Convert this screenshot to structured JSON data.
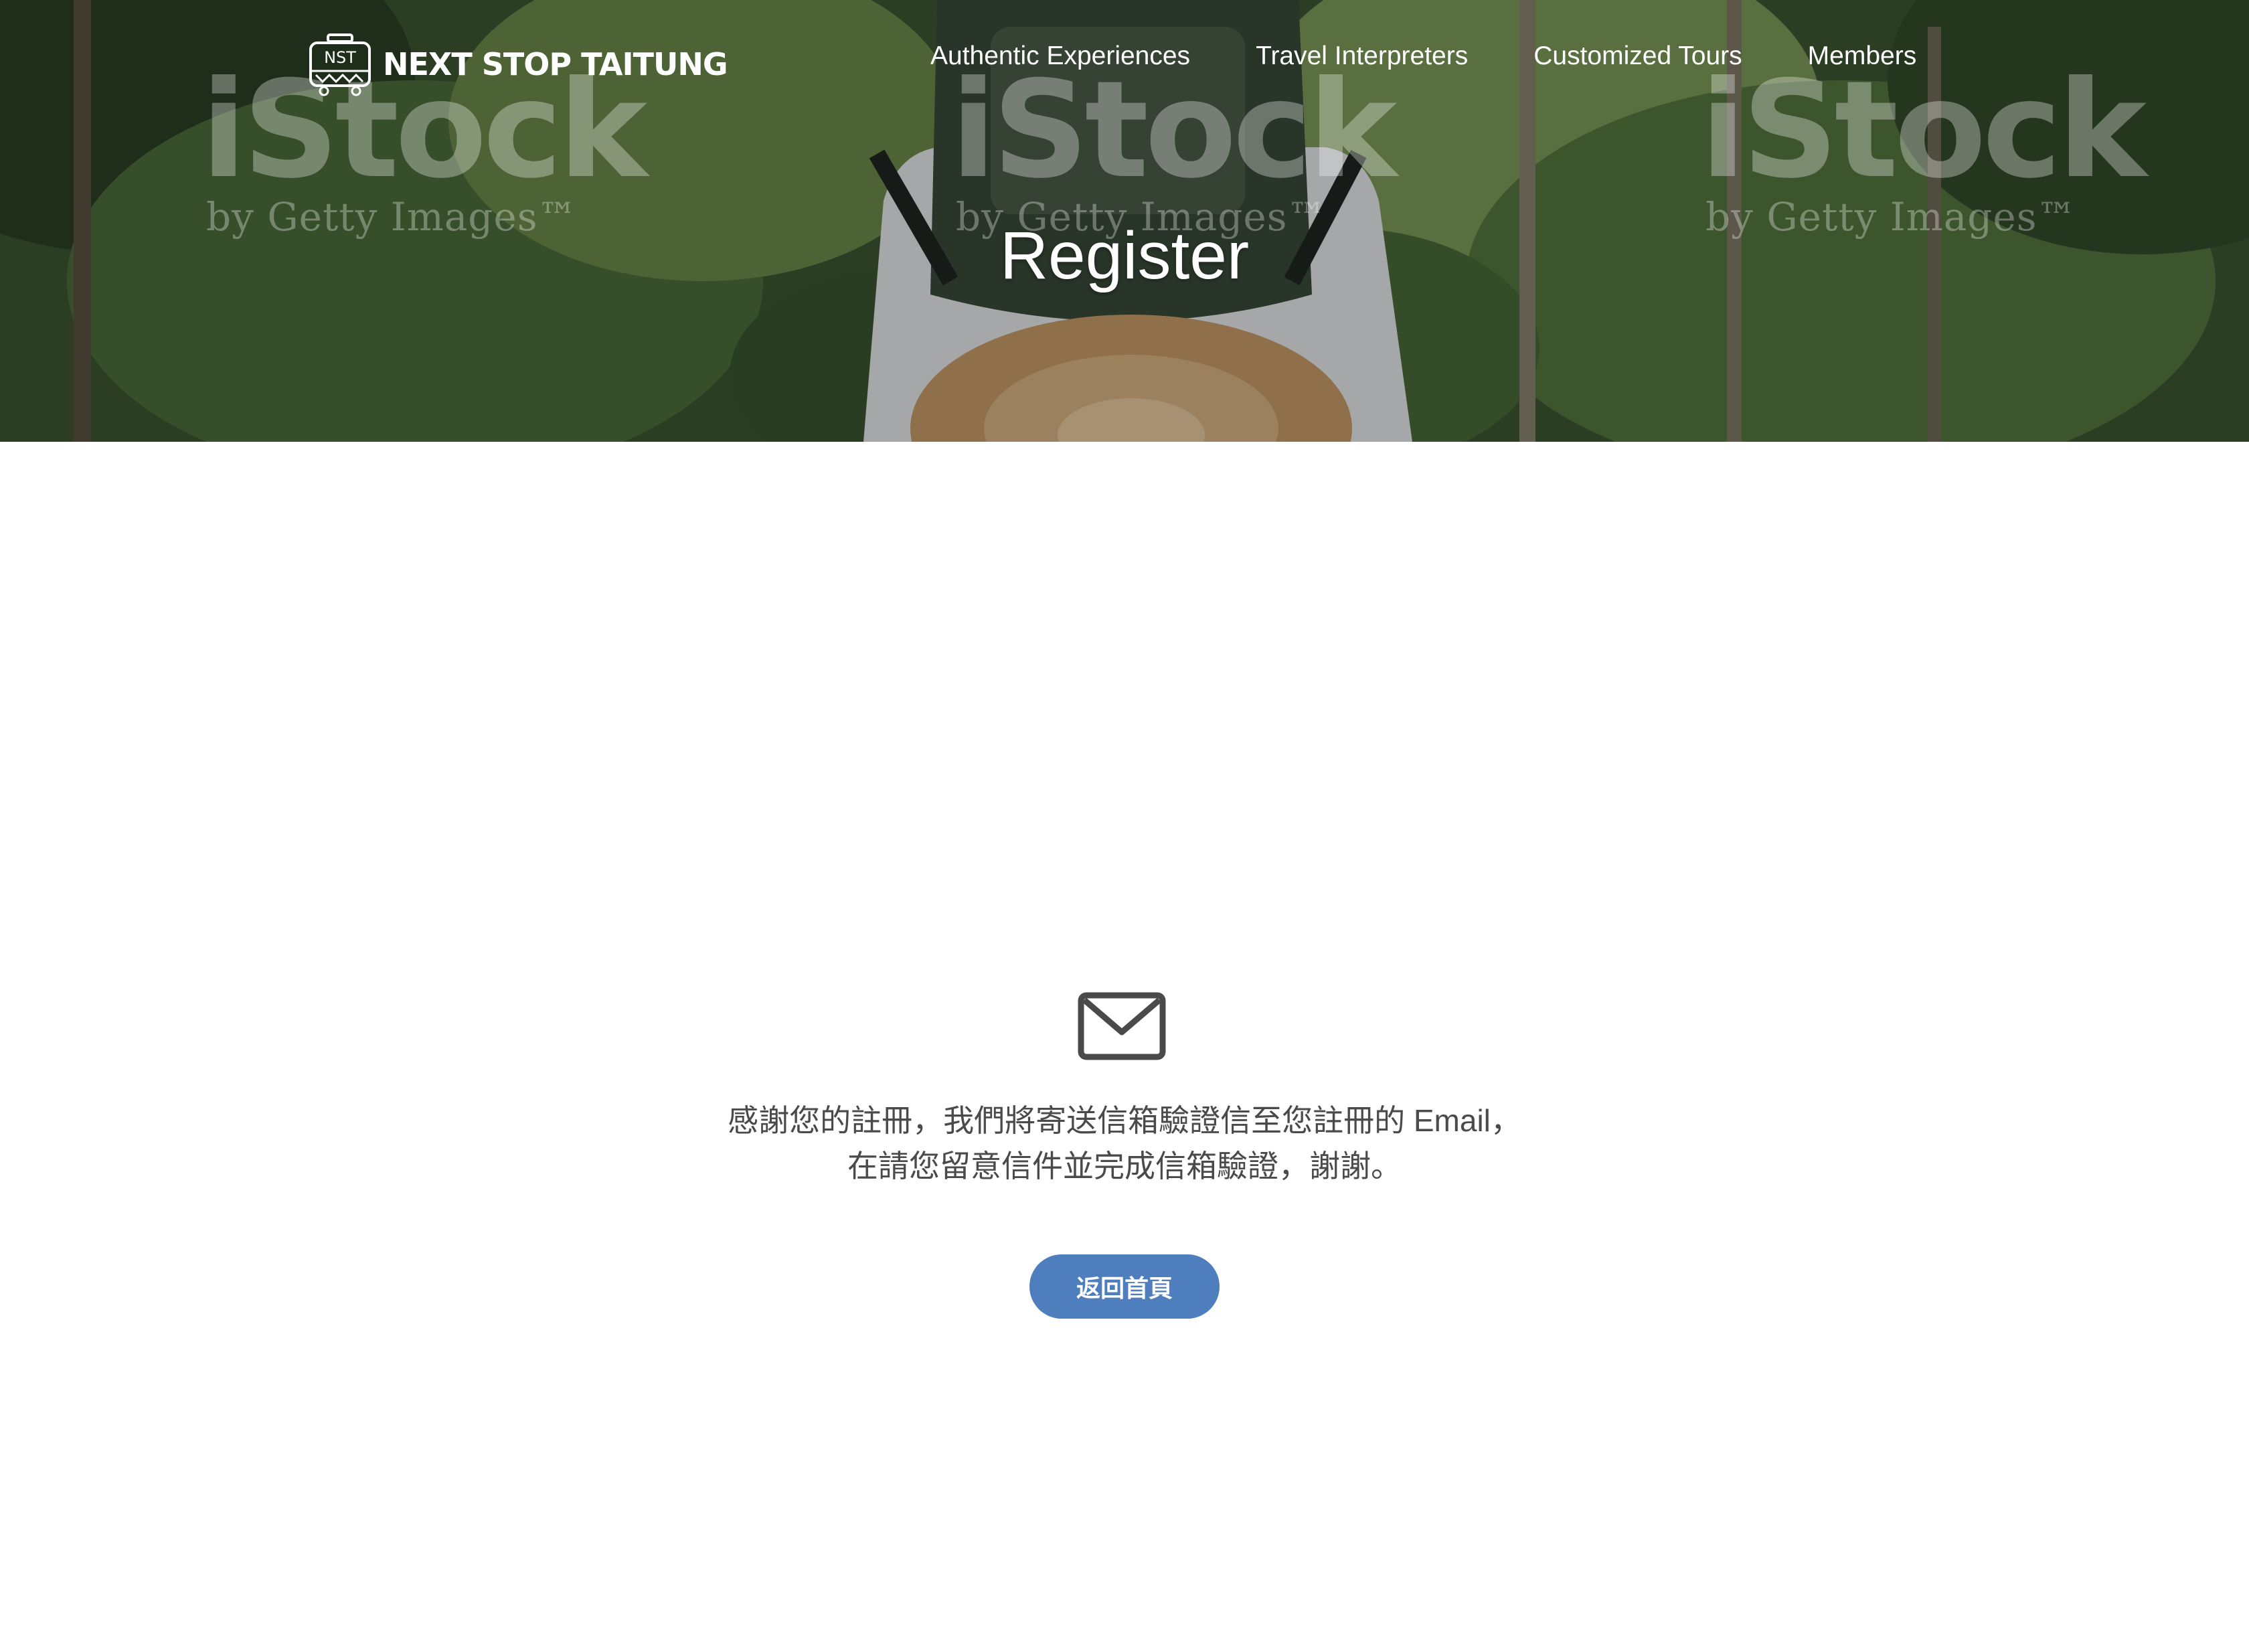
{
  "brand": {
    "logo_badge": "NST",
    "name": "NEXT STOP TAITUNG"
  },
  "nav": {
    "items": [
      {
        "label": "Authentic Experiences"
      },
      {
        "label": "Travel Interpreters"
      },
      {
        "label": "Customized Tours"
      },
      {
        "label": "Members"
      }
    ]
  },
  "hero": {
    "title": "Register",
    "watermark_main": "iStock",
    "watermark_sub": "by Getty Images™"
  },
  "message": {
    "line1": "感謝您的註冊，我們將寄送信箱驗證信至您註冊的 Email，",
    "line2": "在請您留意信件並完成信箱驗證，謝謝。",
    "icon": "envelope-icon"
  },
  "actions": {
    "home_label": "返回首頁"
  },
  "colors": {
    "button": "#4e7ebd",
    "body_text": "#4a4a4a",
    "icon": "#4a4a4a"
  }
}
